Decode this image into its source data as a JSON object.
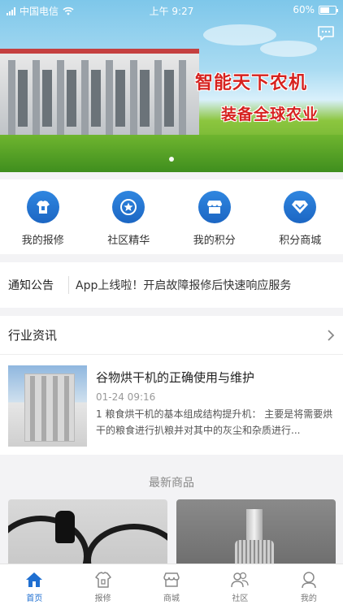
{
  "status_bar": {
    "carrier": "中国电信",
    "time": "上午 9:27",
    "battery": "60%",
    "battery_level": 0.6
  },
  "banner": {
    "slogan_line1": "智能天下农机",
    "slogan_line2": "装备全球农业",
    "slide_count": 1,
    "active_slide": 0
  },
  "quick_menu": [
    {
      "label": "我的报修",
      "icon": "repair-shirt-icon"
    },
    {
      "label": "社区精华",
      "icon": "star-badge-icon"
    },
    {
      "label": "我的积分",
      "icon": "store-icon"
    },
    {
      "label": "积分商城",
      "icon": "diamond-icon"
    }
  ],
  "notice": {
    "title": "通知公告",
    "text": "App上线啦！开启故障报修后快速响应服务"
  },
  "news": {
    "section_title": "行业资讯",
    "items": [
      {
        "title": "谷物烘干机的正确使用与维护",
        "date": "01-24 09:16",
        "summary": "1 粮食烘干机的基本组成结构提升机： 主要是将需要烘干的粮食进行扒粮并对其中的灰尘和杂质进行..."
      }
    ]
  },
  "products": {
    "section_title": "最新商品"
  },
  "tabbar": {
    "active": 0,
    "tabs": [
      {
        "label": "首页",
        "icon": "home-icon"
      },
      {
        "label": "报修",
        "icon": "repair-icon"
      },
      {
        "label": "商城",
        "icon": "shop-icon"
      },
      {
        "label": "社区",
        "icon": "community-icon"
      },
      {
        "label": "我的",
        "icon": "profile-icon"
      }
    ]
  },
  "colors": {
    "accent": "#1f6fd1",
    "slogan": "#d6221f"
  }
}
